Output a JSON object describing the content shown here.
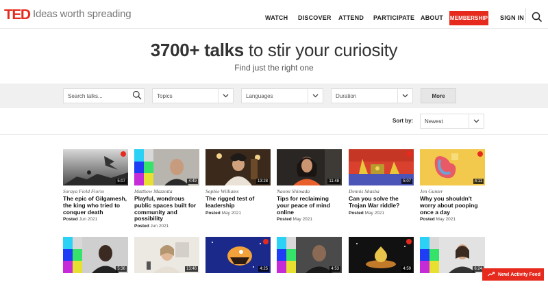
{
  "header": {
    "logo": "TED",
    "tagline": "Ideas worth spreading",
    "nav": [
      "WATCH",
      "DISCOVER",
      "ATTEND",
      "PARTICIPATE",
      "ABOUT"
    ],
    "membership_label": "MEMBERSHIP",
    "signin_label": "SIGN IN"
  },
  "hero": {
    "title_bold": "3700+ talks",
    "title_rest": " to stir your curiosity",
    "subtitle": "Find just the right one"
  },
  "filters": {
    "search_placeholder": "Search talks...",
    "topics": "Topics",
    "languages": "Languages",
    "duration": "Duration",
    "more_label": "More"
  },
  "sort": {
    "label": "Sort by:",
    "value": "Newest"
  },
  "talks_row1": [
    {
      "speaker": "Soraya Field Fiorio",
      "title": "The epic of Gilgamesh, the king who tried to conquer death",
      "posted_label": "Posted",
      "date": "Jun 2021",
      "duration": "5:07"
    },
    {
      "speaker": "Matthew Mazzotta",
      "title": "Playful, wondrous public spaces built for community and possibility",
      "posted_label": "Posted",
      "date": "Jun 2021",
      "duration": "4:49"
    },
    {
      "speaker": "Sophie Williams",
      "title": "The rigged test of leadership",
      "posted_label": "Posted",
      "date": "May 2021",
      "duration": "13:28"
    },
    {
      "speaker": "Naomi Shimada",
      "title": "Tips for reclaiming your peace of mind online",
      "posted_label": "Posted",
      "date": "May 2021",
      "duration": "11:48"
    },
    {
      "speaker": "Dennis Shasha",
      "title": "Can you solve the Trojan War riddle?",
      "posted_label": "Posted",
      "date": "May 2021",
      "duration": "5:07"
    },
    {
      "speaker": "Jen Gunter",
      "title": "Why you shouldn't worry about pooping once a day",
      "posted_label": "Posted",
      "date": "May 2021",
      "duration": "4:11"
    }
  ],
  "talks_row2": [
    {
      "duration": "5:36"
    },
    {
      "duration": "13:46"
    },
    {
      "duration": "4:25"
    },
    {
      "duration": "4:53"
    },
    {
      "duration": "4:59"
    },
    {
      "duration": "6:24"
    }
  ],
  "activity_feed_label": "New! Activity Feed",
  "colors": {
    "brand_red": "#e62b1e",
    "filter_band": "#f0f0f0"
  }
}
